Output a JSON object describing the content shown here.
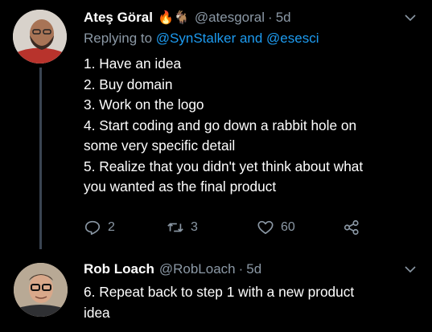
{
  "tweets": [
    {
      "name": "Ateş Göral",
      "emoji": "🔥🐐",
      "handle": "@atesgoral",
      "time": "5d",
      "replying_prefix": "Replying to ",
      "replying_mentions": "@SynStalker and @esesci",
      "lines": [
        "1. Have an idea",
        "2. Buy domain",
        "3. Work on the logo",
        "4. Start coding and go down a rabbit hole on",
        "some very specific detail",
        "5. Realize that you didn't yet think about what",
        "you wanted as the final product"
      ],
      "replies": "2",
      "retweets": "3",
      "likes": "60"
    },
    {
      "name": "Rob Loach",
      "handle": "@RobLoach",
      "time": "5d",
      "lines": [
        "6. Repeat back to step 1 with a new product",
        "idea"
      ]
    }
  ],
  "icons": {
    "reply": "reply-icon",
    "retweet": "retweet-icon",
    "like": "heart-icon",
    "share": "share-icon",
    "caret": "chevron-down-icon"
  },
  "colors": {
    "background": "#000000",
    "muted": "#8b98a5",
    "link": "#1d9bf0",
    "thread_line": "#3a4452"
  }
}
